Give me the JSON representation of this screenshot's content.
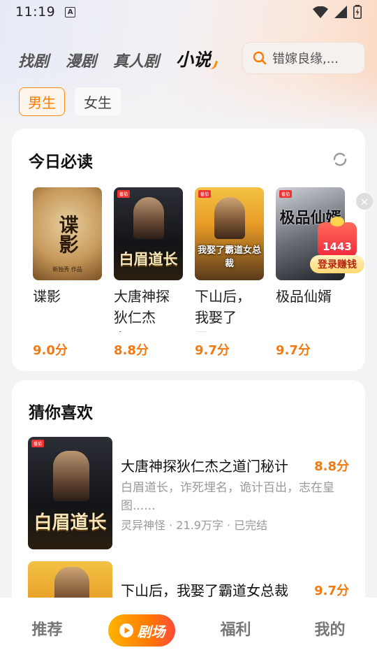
{
  "status": {
    "time": "11:19",
    "notif_glyph": "A"
  },
  "top_tabs": [
    "找剧",
    "漫剧",
    "真人剧",
    "小说"
  ],
  "search": {
    "text": "错嫁良缘,..."
  },
  "gender": [
    "男生",
    "女生"
  ],
  "today": {
    "title": "今日必读",
    "books": [
      {
        "title": "谍影",
        "score": "9.0分",
        "cover_text": "谍影",
        "cover_author": "新独秀 作品"
      },
      {
        "title": "大唐神探狄仁杰之...",
        "score": "8.8分",
        "cover_text": "白眉道长"
      },
      {
        "title": "下山后，我娶了霸...",
        "score": "9.7分",
        "cover_text": "我娶了霸道女总裁"
      },
      {
        "title": "极品仙婿",
        "score": "9.7分",
        "cover_text": "极品仙婿"
      }
    ]
  },
  "promo": {
    "count": "1443",
    "label": "登录赚钱",
    "close": "×"
  },
  "guess": {
    "title": "猜你喜欢",
    "items": [
      {
        "title": "大唐神探狄仁杰之道门秘计",
        "score": "8.8分",
        "desc": "白眉道长，诈死埋名，诡计百出，志在皇图......",
        "meta": "灵异神怪 · 21.9万字 · 已完结",
        "cover_text": "白眉道长"
      },
      {
        "title": "下山后，我娶了霸道女总裁",
        "score": "9.7分"
      }
    ]
  },
  "nav": {
    "recommend": "推荐",
    "theater": "剧场",
    "welfare": "福利",
    "mine": "我的"
  }
}
